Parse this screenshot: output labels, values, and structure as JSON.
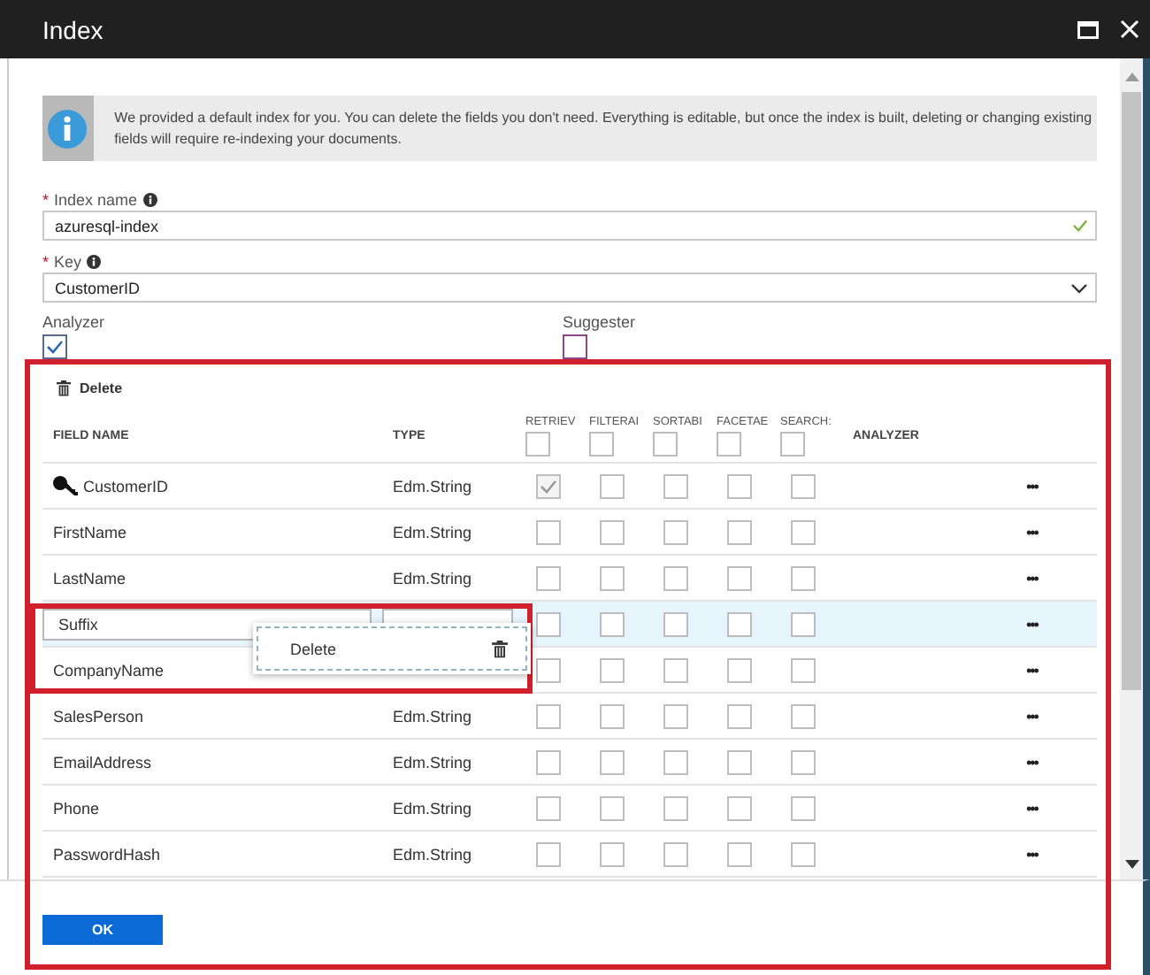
{
  "window": {
    "title": "Index"
  },
  "info": {
    "text": "We provided a default index for you. You can delete the fields you don't need. Everything is editable, but once the index is built, deleting or changing existing fields will require re-indexing your documents."
  },
  "index_name": {
    "label": "Index name",
    "required_mark": "*",
    "value": "azuresql-index",
    "valid": true
  },
  "key": {
    "label": "Key",
    "required_mark": "*",
    "value": "CustomerID"
  },
  "options": [
    {
      "label": "Analyzer",
      "checked": true
    },
    {
      "label": "Suggester",
      "checked": false
    }
  ],
  "toolbar": {
    "delete": "Delete"
  },
  "columns": [
    {
      "label": "FIELD NAME",
      "kind": "text"
    },
    {
      "label": "TYPE",
      "kind": "text"
    },
    {
      "label": "RETRIEV",
      "kind": "check",
      "checked": false
    },
    {
      "label": "FILTERAI",
      "kind": "check",
      "checked": false
    },
    {
      "label": "SORTABI",
      "kind": "check",
      "checked": false
    },
    {
      "label": "FACETAE",
      "kind": "check",
      "checked": false
    },
    {
      "label": "SEARCH:",
      "kind": "check",
      "checked": false
    },
    {
      "label": "ANALYZER",
      "kind": "text"
    }
  ],
  "rows": [
    {
      "name": "CustomerID",
      "type": "Edm.String",
      "key": true,
      "selected": false,
      "checks": [
        true,
        false,
        false,
        false,
        false
      ],
      "more": "•••"
    },
    {
      "name": "FirstName",
      "type": "Edm.String",
      "key": false,
      "selected": false,
      "checks": [
        false,
        false,
        false,
        false,
        false
      ],
      "more": "•••"
    },
    {
      "name": "LastName",
      "type": "Edm.String",
      "key": false,
      "selected": false,
      "checks": [
        false,
        false,
        false,
        false,
        false
      ],
      "more": "•••"
    },
    {
      "name": "Suffix",
      "key": false,
      "selected": true,
      "checks": [
        false,
        false,
        false,
        false,
        false
      ],
      "more": "•••",
      "menu": [
        {
          "label": "Delete"
        }
      ]
    },
    {
      "name": "CompanyName",
      "key": false,
      "selected": false,
      "checks": [
        false,
        false,
        false,
        false,
        false
      ],
      "more": "•••"
    },
    {
      "name": "SalesPerson",
      "type": "Edm.String",
      "key": false,
      "selected": false,
      "checks": [
        false,
        false,
        false,
        false,
        false
      ],
      "more": "•••"
    },
    {
      "name": "EmailAddress",
      "type": "Edm.String",
      "key": false,
      "selected": false,
      "checks": [
        false,
        false,
        false,
        false,
        false
      ],
      "more": "•••"
    },
    {
      "name": "Phone",
      "type": "Edm.String",
      "key": false,
      "selected": false,
      "checks": [
        false,
        false,
        false,
        false,
        false
      ],
      "more": "•••"
    },
    {
      "name": "PasswordHash",
      "type": "Edm.String",
      "key": false,
      "selected": false,
      "checks": [
        false,
        false,
        false,
        false,
        false
      ],
      "more": "•••"
    }
  ],
  "ok_button": "OK"
}
